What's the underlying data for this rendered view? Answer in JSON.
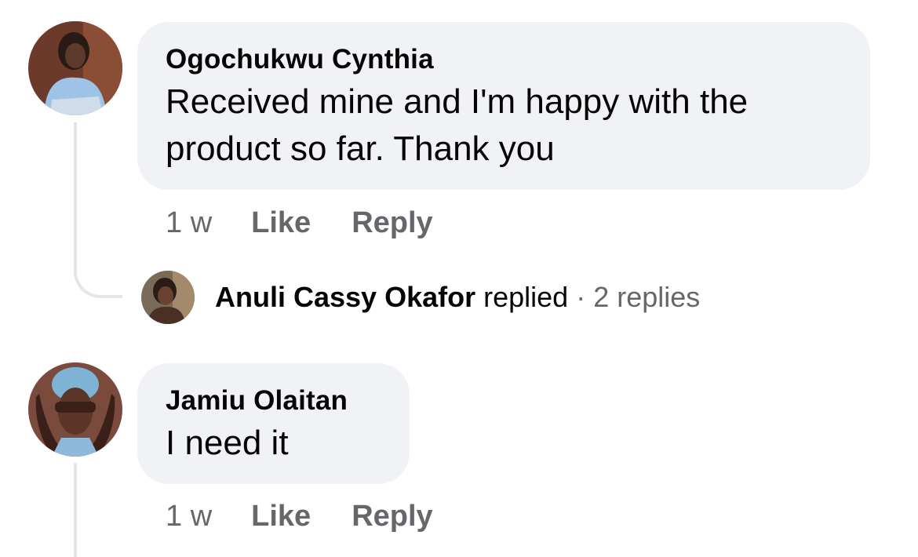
{
  "comments": [
    {
      "author": "Ogochukwu Cynthia",
      "text_lines": [
        "Received mine and I'm happy with the",
        "product so far. Thank you"
      ],
      "time": "1 w",
      "like_label": "Like",
      "reply_label": "Reply",
      "replies_summary": {
        "name": "Anuli Cassy Okafor",
        "verb": "replied",
        "separator": "·",
        "count_text": "2 replies"
      }
    },
    {
      "author": "Jamiu Olaitan",
      "text_lines": [
        "I need it"
      ],
      "time": "1 w",
      "like_label": "Like",
      "reply_label": "Reply"
    }
  ],
  "colors": {
    "bubble": "#f0f2f5",
    "meta_text": "#65676b",
    "primary_text": "#050505",
    "thread_line": "#e4e6eb"
  }
}
